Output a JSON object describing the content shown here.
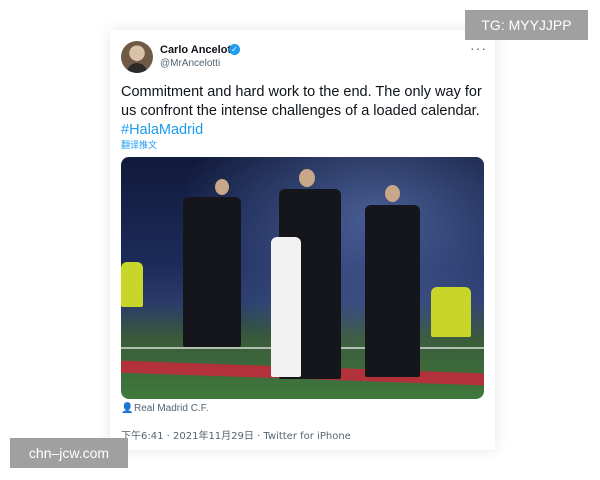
{
  "tweet": {
    "author_name": "Carlo Ancelotti",
    "author_handle": "@MrAncelotti",
    "text_main": "Commitment and hard work to the end. The only way for us confront the intense challenges of a loaded calendar.",
    "hashtag": "#HalaMadrid",
    "translate_label": "翻译推文",
    "more_label": "···",
    "verified_glyph": "✓",
    "media_alt": "",
    "tagged_account": "Real Madrid C.F.",
    "person_glyph": "👤",
    "timestamp": "下午6:41 · 2021年11月29日 · Twitter for iPhone"
  },
  "overlays": {
    "tg_label": "TG: MYYJJPP",
    "site_label": "chn–jcw.com"
  },
  "colors": {
    "link_blue": "#1d9bf0",
    "muted_text": "#536471",
    "overlay_gray": "#a0a0a0"
  }
}
